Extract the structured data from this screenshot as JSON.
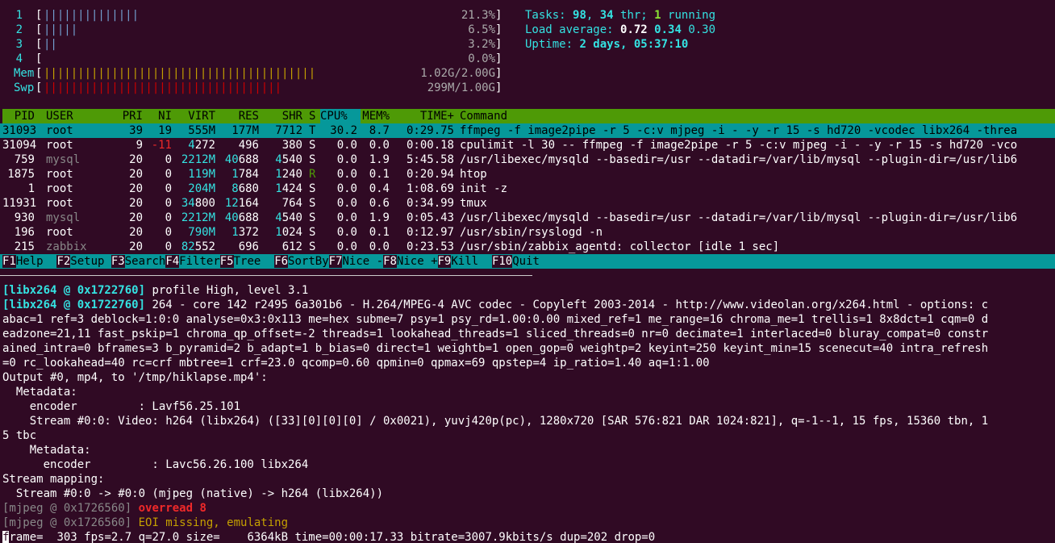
{
  "cpu_meters": [
    {
      "id": "1",
      "open": "[",
      "usr": "||||||||||||||",
      "sys": "",
      "value": "21.3%",
      "close": "]",
      "fraction": 0.213
    },
    {
      "id": "2",
      "open": "[",
      "usr": "|||||",
      "sys": "",
      "value": "6.5%",
      "close": "]",
      "fraction": 0.065
    },
    {
      "id": "3",
      "open": "[",
      "usr": "||",
      "sys": "",
      "value": "3.2%",
      "close": "]",
      "fraction": 0.032
    },
    {
      "id": "4",
      "open": "[",
      "usr": "",
      "sys": "",
      "value": "0.0%",
      "close": "]",
      "fraction": 0.0
    }
  ],
  "mem_meter": {
    "label": "Mem",
    "open": "[",
    "bars": "||||||||||||||||||||||||||||||||||||||||",
    "value": "1.02G/2.00G",
    "close": "]"
  },
  "swp_meter": {
    "label": "Swp",
    "open": "[",
    "bars": "|||||||||||||||||||||||||||||||||||",
    "value": "299M/1.00G",
    "close": "]"
  },
  "summary": {
    "tasks_label": "Tasks: ",
    "tasks": "98",
    "tasks_sep": ", ",
    "thr": "34",
    "thr_label": " thr; ",
    "running": "1",
    "running_label": " running",
    "load_label": "Load average: ",
    "load1": "0.72",
    "load5": "0.34",
    "load15": "0.30",
    "uptime_label": "Uptime: ",
    "uptime": "2 days, 05:37:10"
  },
  "columns": [
    "PID",
    "USER",
    "PRI",
    "NI",
    "VIRT",
    "RES",
    "SHR",
    "S",
    "CPU%",
    "MEM%",
    "TIME+",
    "Command"
  ],
  "processes": [
    {
      "pid": "31093",
      "user": "root",
      "pri": "39",
      "ni": "19",
      "virt": "555M",
      "res": "177M",
      "shr": "7712",
      "s": "T",
      "cpu": "30.2",
      "mem": "8.7",
      "time": "0:29.75",
      "cmd": "ffmpeg -f image2pipe -r 5 -c:v mjpeg -i - -y -r 15 -s hd720 -vcodec libx264 -threa"
    },
    {
      "pid": "31094",
      "user": "root",
      "pri": "9",
      "ni": "-11",
      "virt": "4272",
      "res": "496",
      "shr": "380",
      "s": "S",
      "cpu": "0.0",
      "mem": "0.0",
      "time": "0:00.18",
      "cmd": "cpulimit -l 30 -- ffmpeg -f image2pipe -r 5 -c:v mjpeg -i - -y -r 15 -s hd720 -vco"
    },
    {
      "pid": "759",
      "user": "mysql",
      "pri": "20",
      "ni": "0",
      "virt": "2212M",
      "res": "40688",
      "shr": "4540",
      "s": "S",
      "cpu": "0.0",
      "mem": "1.9",
      "time": "5:45.58",
      "cmd": "/usr/libexec/mysqld --basedir=/usr --datadir=/var/lib/mysql --plugin-dir=/usr/lib6"
    },
    {
      "pid": "1875",
      "user": "root",
      "pri": "20",
      "ni": "0",
      "virt": "119M",
      "res": "1784",
      "shr": "1240",
      "s": "R",
      "cpu": "0.0",
      "mem": "0.1",
      "time": "0:20.94",
      "cmd": "htop"
    },
    {
      "pid": "1",
      "user": "root",
      "pri": "20",
      "ni": "0",
      "virt": "204M",
      "res": "8680",
      "shr": "1424",
      "s": "S",
      "cpu": "0.0",
      "mem": "0.4",
      "time": "1:08.69",
      "cmd": "init -z"
    },
    {
      "pid": "11931",
      "user": "root",
      "pri": "20",
      "ni": "0",
      "virt": "34800",
      "res": "12164",
      "shr": "764",
      "s": "S",
      "cpu": "0.0",
      "mem": "0.6",
      "time": "0:34.99",
      "cmd": "tmux"
    },
    {
      "pid": "930",
      "user": "mysql",
      "pri": "20",
      "ni": "0",
      "virt": "2212M",
      "res": "40688",
      "shr": "4540",
      "s": "S",
      "cpu": "0.0",
      "mem": "1.9",
      "time": "0:05.43",
      "cmd": "/usr/libexec/mysqld --basedir=/usr --datadir=/var/lib/mysql --plugin-dir=/usr/lib6"
    },
    {
      "pid": "196",
      "user": "root",
      "pri": "20",
      "ni": "0",
      "virt": "790M",
      "res": "1372",
      "shr": "1024",
      "s": "S",
      "cpu": "0.0",
      "mem": "0.1",
      "time": "0:12.97",
      "cmd": "/usr/sbin/rsyslogd -n"
    },
    {
      "pid": "215",
      "user": "zabbix",
      "pri": "20",
      "ni": "0",
      "virt": "82552",
      "res": "696",
      "shr": "612",
      "s": "S",
      "cpu": "0.0",
      "mem": "0.0",
      "time": "0:23.53",
      "cmd": "/usr/sbin/zabbix_agentd: collector [idle 1 sec]"
    }
  ],
  "function_keys": [
    {
      "key": "F1",
      "label": "Help  "
    },
    {
      "key": "F2",
      "label": "Setup "
    },
    {
      "key": "F3",
      "label": "Search"
    },
    {
      "key": "F4",
      "label": "Filter"
    },
    {
      "key": "F5",
      "label": "Tree  "
    },
    {
      "key": "F6",
      "label": "SortBy"
    },
    {
      "key": "F7",
      "label": "Nice -"
    },
    {
      "key": "F8",
      "label": "Nice +"
    },
    {
      "key": "F9",
      "label": "Kill  "
    },
    {
      "key": "F10",
      "label": "Quit"
    }
  ],
  "log": {
    "l1_tag": "[libx264 @ 0x1722760]",
    "l1_text": " profile High, level 3.1",
    "l2_tag": "[libx264 @ 0x1722760]",
    "l2_text": " 264 - core 142 r2495 6a301b6 - H.264/MPEG-4 AVC codec - Copyleft 2003-2014 - http://www.videolan.org/x264.html - options: c",
    "l3": "abac=1 ref=3 deblock=1:0:0 analyse=0x3:0x113 me=hex subme=7 psy=1 psy_rd=1.00:0.00 mixed_ref=1 me_range=16 chroma_me=1 trellis=1 8x8dct=1 cqm=0 d",
    "l4": "eadzone=21,11 fast_pskip=1 chroma_qp_offset=-2 threads=1 lookahead_threads=1 sliced_threads=0 nr=0 decimate=1 interlaced=0 bluray_compat=0 constr",
    "l5": "ained_intra=0 bframes=3 b_pyramid=2 b_adapt=1 b_bias=0 direct=1 weightb=1 open_gop=0 weightp=2 keyint=250 keyint_min=15 scenecut=40 intra_refresh",
    "l6": "=0 rc_lookahead=40 rc=crf mbtree=1 crf=23.0 qcomp=0.60 qpmin=0 qpmax=69 qpstep=4 ip_ratio=1.40 aq=1:1.00",
    "l7": "Output #0, mp4, to '/tmp/hiklapse.mp4':",
    "l8": "  Metadata:",
    "l9": "    encoder         : Lavf56.25.101",
    "l10": "    Stream #0:0: Video: h264 (libx264) ([33][0][0][0] / 0x0021), yuvj420p(pc), 1280x720 [SAR 576:821 DAR 1024:821], q=-1--1, 15 fps, 15360 tbn, 1",
    "l11": "5 tbc",
    "l12": "    Metadata:",
    "l13": "      encoder         : Lavc56.26.100 libx264",
    "l14": "Stream mapping:",
    "l15": "  Stream #0:0 -> #0:0 (mjpeg (native) -> h264 (libx264))",
    "l16_tag": "[mjpeg @ 0x1726560]",
    "l16_text": " overread 8",
    "l17_tag": "[mjpeg @ 0x1726560]",
    "l17_text": " EOI missing, emulating",
    "l18_cursor": "f",
    "l18_text": "rame=  303 fps=2.7 q=27.0 size=    6364kB time=00:00:17.33 bitrate=3007.9kbits/s dup=202 drop=0"
  }
}
